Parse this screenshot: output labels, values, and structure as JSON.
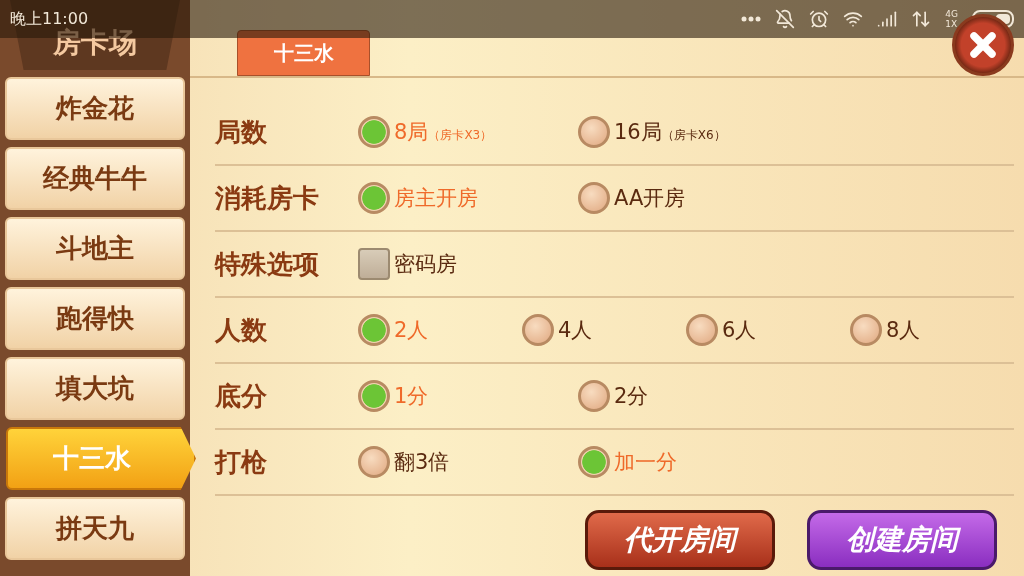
{
  "status_bar": {
    "time": "晚上11:00",
    "network_top": "4G",
    "network_bottom": "1X"
  },
  "sidebar": {
    "title": "房卡场",
    "items": [
      {
        "label": "炸金花",
        "selected": false
      },
      {
        "label": "经典牛牛",
        "selected": false
      },
      {
        "label": "斗地主",
        "selected": false
      },
      {
        "label": "跑得快",
        "selected": false
      },
      {
        "label": "填大坑",
        "selected": false
      },
      {
        "label": "十三水",
        "selected": true
      },
      {
        "label": "拼天九",
        "selected": false
      }
    ]
  },
  "tabs": [
    {
      "label": "十三水",
      "selected": true
    }
  ],
  "options": [
    {
      "label": "局数",
      "kind": "radio",
      "choices": [
        {
          "text": "8局",
          "note": "（房卡X3）",
          "selected": true
        },
        {
          "text": "16局",
          "note": "（房卡X6）",
          "selected": false
        }
      ]
    },
    {
      "label": "消耗房卡",
      "kind": "radio",
      "choices": [
        {
          "text": "房主开房",
          "selected": true
        },
        {
          "text": "AA开房",
          "selected": false
        }
      ]
    },
    {
      "label": "特殊选项",
      "kind": "checkbox",
      "choices": [
        {
          "text": "密码房",
          "selected": false
        }
      ]
    },
    {
      "label": "人数",
      "kind": "radio",
      "choices": [
        {
          "text": "2人",
          "selected": true
        },
        {
          "text": "4人",
          "selected": false
        },
        {
          "text": "6人",
          "selected": false
        },
        {
          "text": "8人",
          "selected": false
        }
      ]
    },
    {
      "label": "底分",
      "kind": "radio",
      "choices": [
        {
          "text": "1分",
          "selected": true
        },
        {
          "text": "2分",
          "selected": false
        }
      ]
    },
    {
      "label": "打枪",
      "kind": "radio",
      "choices": [
        {
          "text": "翻3倍",
          "selected": false
        },
        {
          "text": "加一分",
          "selected": true
        }
      ]
    }
  ],
  "buttons": [
    {
      "label": "代开房间",
      "kind": "secondary"
    },
    {
      "label": "创建房间",
      "kind": "primary"
    }
  ]
}
